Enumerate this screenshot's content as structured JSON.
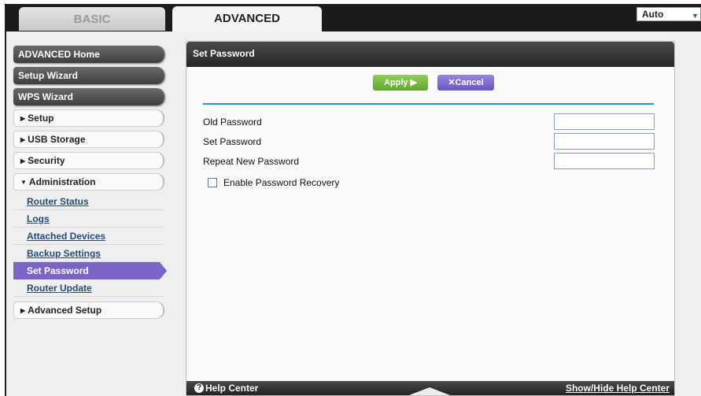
{
  "tabs": {
    "basic": "BASIC",
    "advanced": "ADVANCED"
  },
  "language": {
    "selected": "Auto"
  },
  "sidebar": {
    "primary": [
      "ADVANCED Home",
      "Setup Wizard",
      "WPS Wizard"
    ],
    "sections": [
      {
        "label": "Setup",
        "expanded": false
      },
      {
        "label": "USB Storage",
        "expanded": false
      },
      {
        "label": "Security",
        "expanded": false
      },
      {
        "label": "Administration",
        "expanded": true
      }
    ],
    "admin_items": [
      "Router Status",
      "Logs",
      "Attached Devices",
      "Backup Settings",
      "Set Password",
      "Router Update"
    ],
    "selected_item": "Set Password",
    "advanced_setup": "Advanced Setup"
  },
  "panel": {
    "title": "Set Password",
    "apply_label": "Apply ▶",
    "cancel_label": "✕Cancel",
    "fields": [
      {
        "label": "Old Password",
        "value": ""
      },
      {
        "label": "Set Password",
        "value": ""
      },
      {
        "label": "Repeat New Password",
        "value": ""
      }
    ],
    "recovery_label": "Enable Password Recovery",
    "recovery_checked": false
  },
  "footer": {
    "help_center": "Help Center",
    "toggle_help": "Show/Hide Help Center"
  },
  "colors": {
    "accent_purple": "#7b64c6",
    "apply_green": "#6db33f",
    "rule_blue": "#2c8fc9"
  }
}
